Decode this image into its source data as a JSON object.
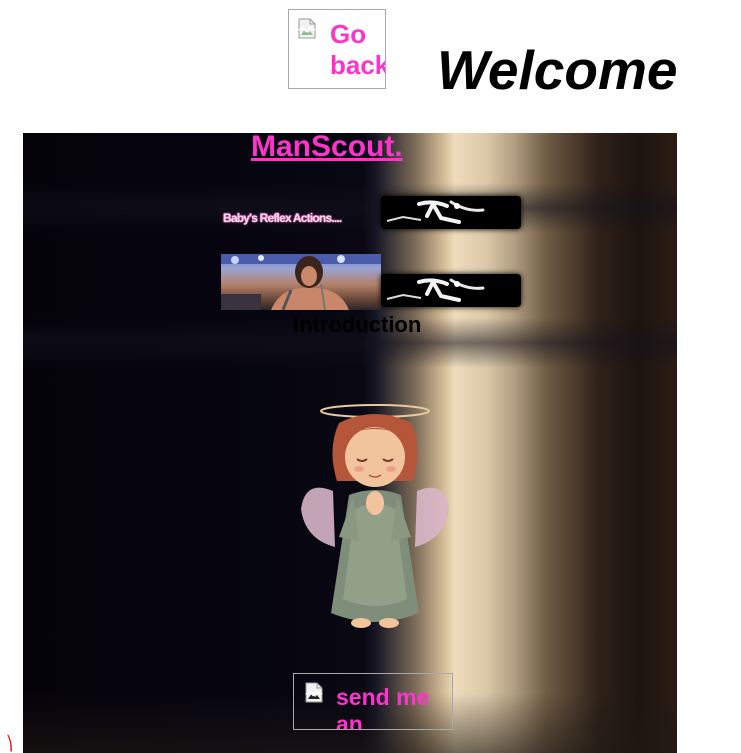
{
  "header": {
    "go_back_alt": "Go back",
    "welcome": "Welcome"
  },
  "panel": {
    "manscout_link": "ManScout.",
    "reflex_text": "Baby's Reflex Actions....",
    "introduction": "Introduction",
    "send_email_alt": "send me an"
  },
  "colors": {
    "link_pink": "#ff33cc",
    "panel_dark": "#050309",
    "panel_light": "#eedcbc"
  },
  "icons": {
    "broken_image": "broken-image-icon",
    "stick_figure": "stick-figure-icon",
    "angel": "angel-image"
  }
}
